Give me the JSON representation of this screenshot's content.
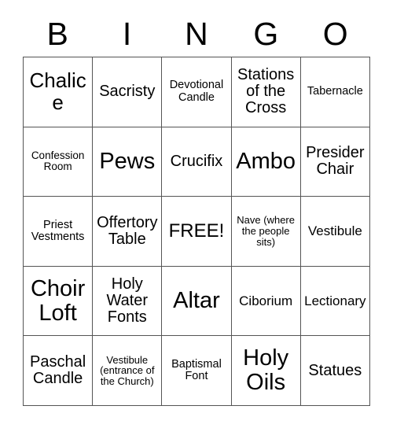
{
  "card": {
    "header_letters": [
      "B",
      "I",
      "N",
      "G",
      "O"
    ],
    "rows": [
      [
        {
          "label": "Chalice",
          "size": "xl"
        },
        {
          "label": "Sacristy",
          "size": "md"
        },
        {
          "label": "Devotional Candle",
          "size": "xs"
        },
        {
          "label": "Stations of the Cross",
          "size": "md"
        },
        {
          "label": "Tabernacle",
          "size": "xs"
        }
      ],
      [
        {
          "label": "Confession Room",
          "size": "xxs"
        },
        {
          "label": "Pews",
          "size": "xxl"
        },
        {
          "label": "Crucifix",
          "size": "md"
        },
        {
          "label": "Ambo",
          "size": "xxl"
        },
        {
          "label": "Presider Chair",
          "size": "md"
        }
      ],
      [
        {
          "label": "Priest Vestments",
          "size": "xs"
        },
        {
          "label": "Offertory Table",
          "size": "md"
        },
        {
          "label": "FREE!",
          "size": "lg"
        },
        {
          "label": "Nave (where the people sits)",
          "size": "tiny"
        },
        {
          "label": "Vestibule",
          "size": "sm"
        }
      ],
      [
        {
          "label": "Choir Loft",
          "size": "xxl"
        },
        {
          "label": "Holy Water Fonts",
          "size": "md"
        },
        {
          "label": "Altar",
          "size": "xxl"
        },
        {
          "label": "Ciborium",
          "size": "sm"
        },
        {
          "label": "Lectionary",
          "size": "sm"
        }
      ],
      [
        {
          "label": "Paschal Candle",
          "size": "md"
        },
        {
          "label": "Vestibule (entrance of the Church)",
          "size": "tiny"
        },
        {
          "label": "Baptismal Font",
          "size": "xs"
        },
        {
          "label": "Holy Oils",
          "size": "xxl"
        },
        {
          "label": "Statues",
          "size": "md"
        }
      ]
    ]
  },
  "colors": {
    "background": "#ffffff",
    "text": "#000000",
    "grid_line": "#555555"
  }
}
